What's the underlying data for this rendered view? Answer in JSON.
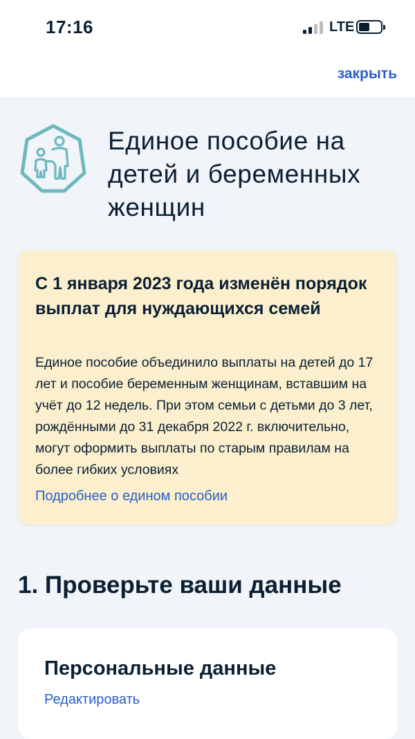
{
  "status_bar": {
    "time": "17:16",
    "network": "LTE",
    "signal_bars_active": 2,
    "signal_bars_total": 4,
    "battery_level": 0.45
  },
  "header": {
    "close_label": "закрыть"
  },
  "hero": {
    "icon": "family-icon",
    "title": "Единое пособие на детей и беременных женщин"
  },
  "notice": {
    "title": "С 1 января 2023 года изменён порядок выплат для нуждающихся семей",
    "body": "Единое пособие объединило выплаты на детей до 17 лет и пособие беременным женщинам, вставшим на учёт до 12 недель. При этом семьи с детьми до 3 лет, рождёнными до 31 декабря 2022 г. включительно, могут оформить выплаты по старым правилам на более гибких условиях",
    "link": "Подробнее о едином пособии"
  },
  "section": {
    "title": "1. Проверьте ваши данные"
  },
  "personal_card": {
    "title": "Персональные данные",
    "edit_label": "Редактировать"
  },
  "colors": {
    "accent": "#2a5fc7",
    "notice_background": "#fbefcd",
    "page_background": "#f1f4f9",
    "icon_color": "#6eb8bf",
    "text": "#0b1f33"
  }
}
